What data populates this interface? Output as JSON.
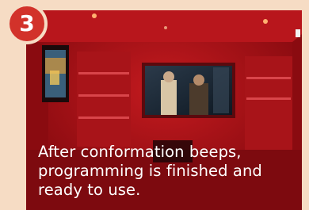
{
  "step": {
    "number": "3"
  },
  "caption": {
    "text": "After conformation beeps, programming is finished and ready to use."
  },
  "photo": {
    "description_icon": "tv-wall-photo"
  },
  "colors": {
    "background": "#f6dcc4",
    "badge": "#d2322a",
    "photo_tint": "#8f0a10",
    "caption_text": "#ffffff"
  }
}
